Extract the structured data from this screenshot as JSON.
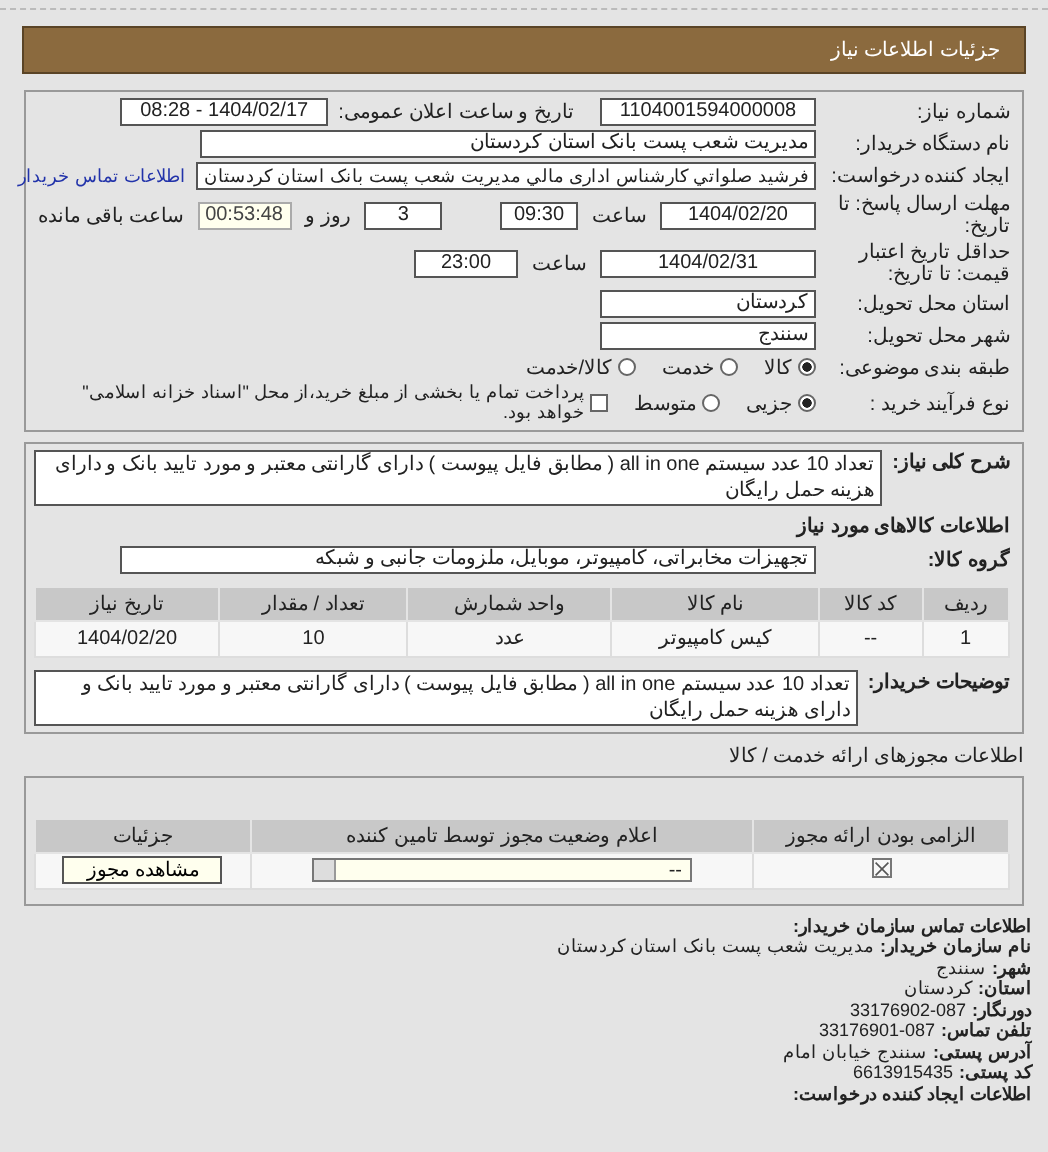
{
  "header": {
    "title": "جزئیات اطلاعات نیاز"
  },
  "need_number": {
    "label": "شماره نیاز:",
    "value": "1104001594000008"
  },
  "announce": {
    "label": "تاریخ و ساعت اعلان عمومی:",
    "value": "1404/02/17 - 08:28"
  },
  "buyer": {
    "label": "نام دستگاه خریدار:",
    "value": "مدیریت شعب پست بانک استان کردستان"
  },
  "requester": {
    "label": "ایجاد کننده درخواست:",
    "value": "فرشید صلواتي کارشناس اداری مالي مدیریت شعب پست بانک استان کردستان",
    "link": "اطلاعات تماس خریدار"
  },
  "deadline": {
    "label": "مهلت ارسال پاسخ: تا تاریخ:",
    "date": "1404/02/20",
    "time_label": "ساعت",
    "time": "09:30",
    "days": "3",
    "days_label": "روز و",
    "remaining": "00:53:48",
    "remaining_label": "ساعت باقی مانده"
  },
  "validity": {
    "label": "حداقل تاریخ اعتبار قیمت: تا تاریخ:",
    "date": "1404/02/31",
    "time_label": "ساعت",
    "time": "23:00"
  },
  "province": {
    "label": "استان محل تحویل:",
    "value": "کردستان"
  },
  "city": {
    "label": "شهر محل تحویل:",
    "value": "سنندج"
  },
  "category": {
    "label": "طبقه بندی موضوعی:",
    "options": [
      {
        "label": "کالا",
        "selected": true
      },
      {
        "label": "خدمت",
        "selected": false
      },
      {
        "label": "کالا/خدمت",
        "selected": false
      }
    ]
  },
  "procurement": {
    "label": "نوع فرآیند خرید :",
    "options": [
      {
        "label": "جزیی",
        "selected": true
      },
      {
        "label": "متوسط",
        "selected": false
      }
    ],
    "payment": {
      "label": "پرداخت تمام یا بخشی از مبلغ خرید،از محل \"اسناد خزانه اسلامی\" خواهد بود.",
      "checked": false
    }
  },
  "description": {
    "label": "شرح کلی نیاز:",
    "value": "تعداد 10 عدد سیستم all in one ( مطابق فایل پیوست ) دارای گارانتی معتبر و مورد تایید بانک و دارای هزینه حمل رایگان"
  },
  "goods_heading": "اطلاعات کالاهای مورد نیاز",
  "group": {
    "label": "گروه کالا:",
    "value": "تجهیزات مخابراتی، کامپیوتر، موبایل، ملزومات جانبی و شبکه"
  },
  "goods_table": {
    "columns": [
      "ردیف",
      "کد کالا",
      "نام کالا",
      "واحد شمارش",
      "تعداد / مقدار",
      "تاریخ نیاز"
    ],
    "rows": [
      [
        "1",
        "--",
        "کیس کامپیوتر",
        "عدد",
        "10",
        "1404/02/20"
      ]
    ]
  },
  "buyer_notes": {
    "label": "توضیحات خریدار:",
    "value": "تعداد 10 عدد سیستم all in one ( مطابق فایل پیوست ) دارای گارانتی معتبر و مورد تایید بانک و دارای هزینه حمل رایگان"
  },
  "licenses": {
    "title": "اطلاعات مجوزهای ارائه خدمت / کالا",
    "columns": [
      "الزامی بودن ارائه مجوز",
      "اعلام وضعیت مجوز توسط تامین کننده",
      "جزئیات"
    ],
    "rows": [
      {
        "required": true,
        "status": "--",
        "button": "مشاهده مجوز"
      }
    ]
  },
  "contact": {
    "heading": "اطلاعات تماس سازمان خریدار:",
    "lines": [
      {
        "label": "نام سازمان خریدار:",
        "value": "مدیریت شعب پست بانک استان کردستان"
      },
      {
        "label": "شهر:",
        "value": "سنندج"
      },
      {
        "label": "استان:",
        "value": "کردستان"
      },
      {
        "label": "دورنگار:",
        "value": "33176902-087"
      },
      {
        "label": "تلفن تماس:",
        "value": "33176901-087"
      },
      {
        "label": "آدرس پستی:",
        "value": "سنندج خیابان امام"
      },
      {
        "label": "کد پستی:",
        "value": "6613915435"
      }
    ],
    "creator_heading": "اطلاعات ایجاد کننده درخواست:"
  }
}
